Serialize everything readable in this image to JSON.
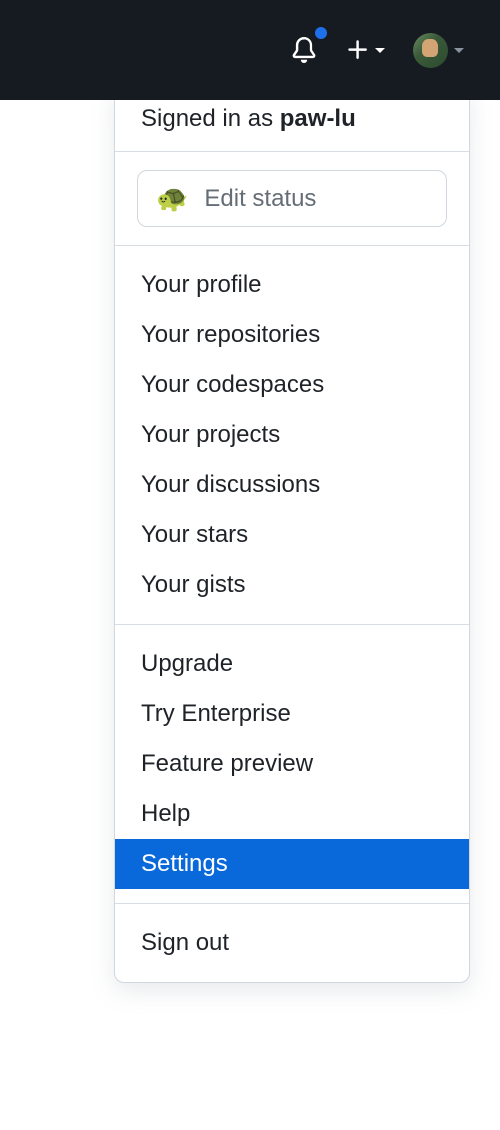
{
  "header": {
    "notifications_unread": true
  },
  "dropdown": {
    "signed_in_prefix": "Signed in as ",
    "username": "paw-lu",
    "status": {
      "emoji": "🐢",
      "label": "Edit status"
    },
    "sections": {
      "your": [
        {
          "label": "Your profile"
        },
        {
          "label": "Your repositories"
        },
        {
          "label": "Your codespaces"
        },
        {
          "label": "Your projects"
        },
        {
          "label": "Your discussions"
        },
        {
          "label": "Your stars"
        },
        {
          "label": "Your gists"
        }
      ],
      "account": [
        {
          "label": "Upgrade"
        },
        {
          "label": "Try Enterprise"
        },
        {
          "label": "Feature preview"
        },
        {
          "label": "Help"
        },
        {
          "label": "Settings",
          "highlighted": true
        }
      ],
      "session": [
        {
          "label": "Sign out"
        }
      ]
    }
  }
}
